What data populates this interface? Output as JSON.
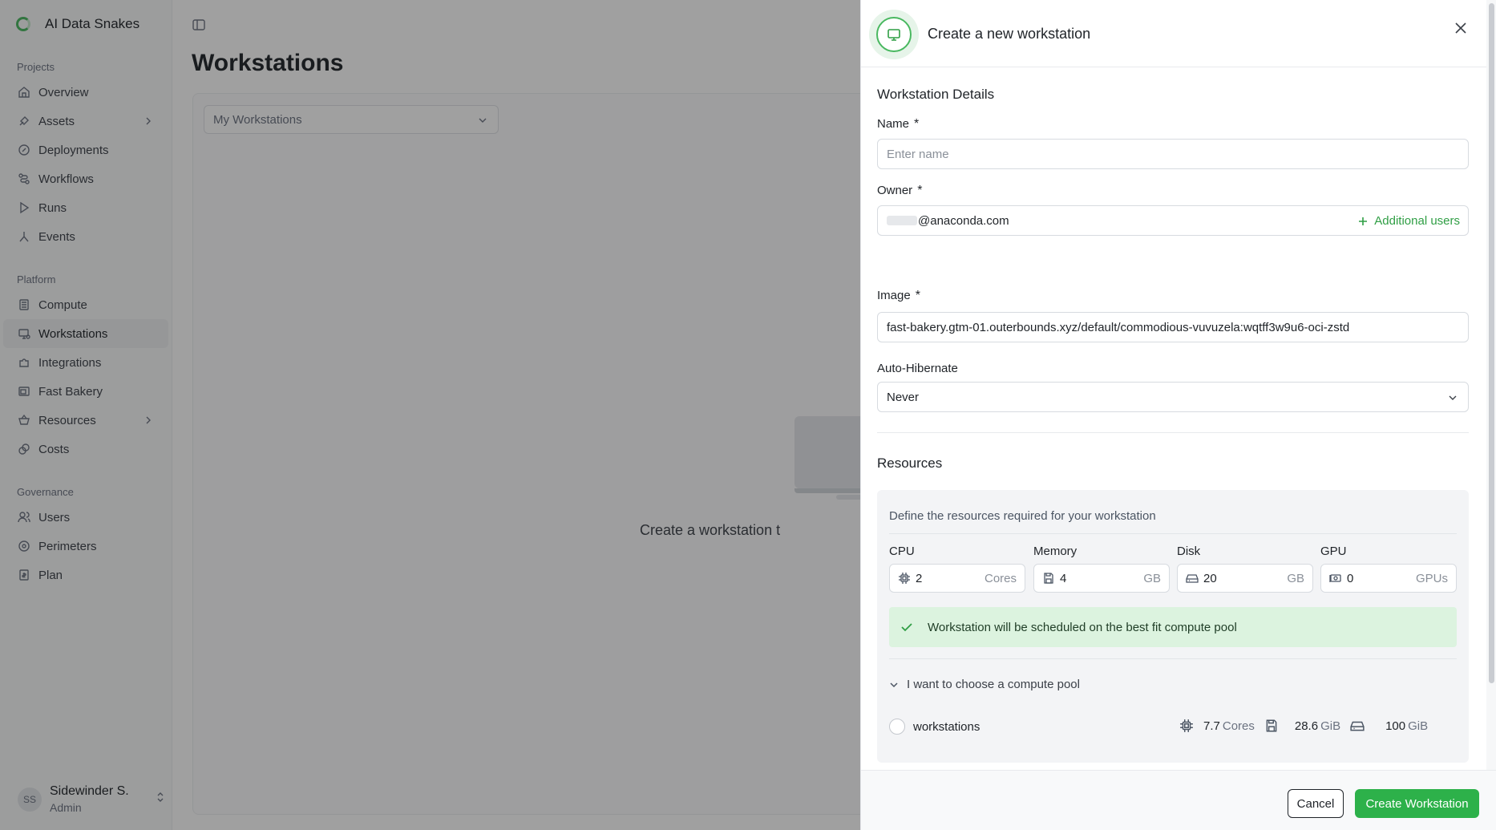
{
  "sidebar": {
    "brand": "AI Data Snakes",
    "sections": [
      {
        "label": "Projects"
      },
      {
        "label": "Platform"
      },
      {
        "label": "Governance"
      }
    ],
    "projects": [
      {
        "label": "Overview",
        "icon": "home-icon"
      },
      {
        "label": "Assets",
        "icon": "assets-icon"
      },
      {
        "label": "Deployments",
        "icon": "deployments-icon"
      },
      {
        "label": "Workflows",
        "icon": "workflows-icon"
      },
      {
        "label": "Runs",
        "icon": "play-icon"
      },
      {
        "label": "Events",
        "icon": "events-icon"
      }
    ],
    "platform": [
      {
        "label": "Compute",
        "icon": "compute-icon"
      },
      {
        "label": "Workstations",
        "icon": "workstations-icon"
      },
      {
        "label": "Integrations",
        "icon": "puzzle-icon"
      },
      {
        "label": "Fast Bakery",
        "icon": "bakery-icon"
      },
      {
        "label": "Resources",
        "icon": "basket-icon"
      },
      {
        "label": "Costs",
        "icon": "coins-icon"
      }
    ],
    "governance": [
      {
        "label": "Users",
        "icon": "users-icon"
      },
      {
        "label": "Perimeters",
        "icon": "perimeter-icon"
      },
      {
        "label": "Plan",
        "icon": "plan-icon"
      }
    ],
    "user": {
      "initials": "SS",
      "name": "Sidewinder S.",
      "role": "Admin"
    }
  },
  "main": {
    "title": "Workstations",
    "filter": "My Workstations",
    "empty_text": "Create a workstation t"
  },
  "drawer": {
    "title": "Create a new workstation",
    "details_heading": "Workstation Details",
    "name": {
      "label": "Name",
      "required": "*",
      "placeholder": "Enter name",
      "value": ""
    },
    "owner": {
      "label": "Owner",
      "required": "*",
      "value": "@anaconda.com",
      "additional": "Additional users"
    },
    "image": {
      "label": "Image",
      "required": "*",
      "value": "fast-bakery.gtm-01.outerbounds.xyz/default/commodious-vuvuzela:wqtff3w9u6-oci-zstd"
    },
    "hibernate": {
      "label": "Auto-Hibernate",
      "value": "Never"
    },
    "resources": {
      "heading": "Resources",
      "description": "Define the resources required for your workstation",
      "cpu": {
        "label": "CPU",
        "value": "2",
        "unit": "Cores"
      },
      "memory": {
        "label": "Memory",
        "value": "4",
        "unit": "GB"
      },
      "disk": {
        "label": "Disk",
        "value": "20",
        "unit": "GB"
      },
      "gpu": {
        "label": "GPU",
        "value": "0",
        "unit": "GPUs"
      },
      "alert": "Workstation will be scheduled on the best fit compute pool",
      "toggle": "I want to choose a compute pool",
      "pool": {
        "name": "workstations",
        "cores": "7.7",
        "cores_unit": "Cores",
        "memory": "28.6",
        "memory_unit": "GiB",
        "disk": "100",
        "disk_unit": "GiB"
      }
    },
    "cancel": "Cancel",
    "create": "Create Workstation"
  },
  "colors": {
    "accent": "#2db14a",
    "alert_bg": "#dcf3df"
  }
}
